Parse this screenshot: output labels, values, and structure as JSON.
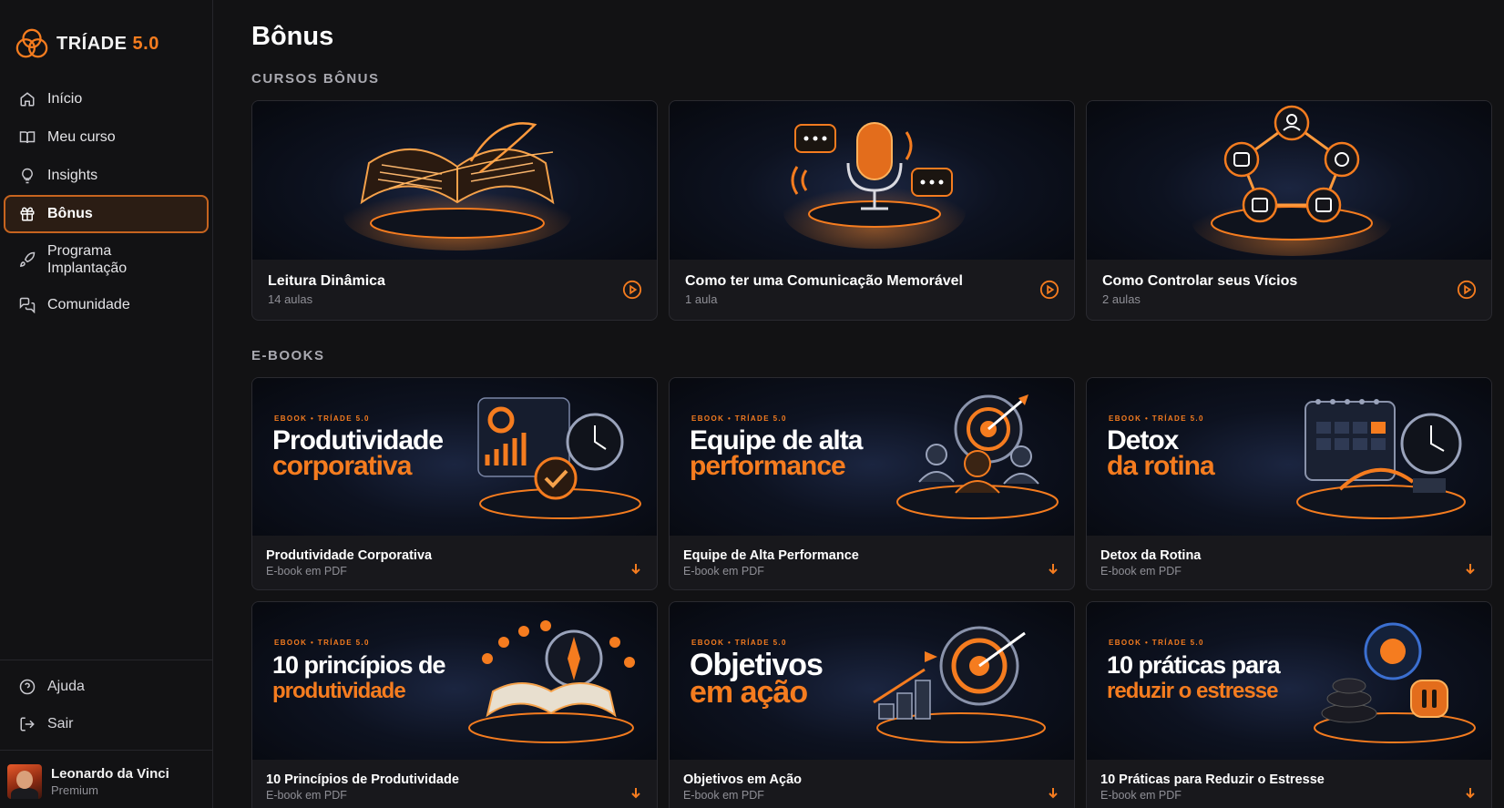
{
  "sidebar": {
    "brand": {
      "text": "TRÍADE",
      "version": "5.0"
    },
    "items": [
      {
        "label": "Início",
        "icon": "home-icon"
      },
      {
        "label": "Meu curso",
        "icon": "book-icon"
      },
      {
        "label": "Insights",
        "icon": "lightbulb-icon"
      },
      {
        "label": "Bônus",
        "icon": "gift-icon",
        "active": true
      },
      {
        "label": "Programa\nImplantação",
        "icon": "rocket-icon"
      },
      {
        "label": "Comunidade",
        "icon": "chat-icon"
      }
    ],
    "bottom": [
      {
        "label": "Ajuda",
        "icon": "help-icon"
      },
      {
        "label": "Sair",
        "icon": "logout-icon"
      }
    ],
    "user": {
      "name": "Leonardo da Vinci",
      "plan": "Premium"
    }
  },
  "main": {
    "title": "Bônus",
    "courses_section": "CURSOS BÔNUS",
    "courses": [
      {
        "title": "Leitura Dinâmica",
        "subtitle": "14 aulas",
        "art": "book"
      },
      {
        "title": "Como ter uma Comunicação Memorável",
        "subtitle": "1 aula",
        "art": "mic"
      },
      {
        "title": "Como Controlar seus Vícios",
        "subtitle": "2 aulas",
        "art": "network"
      }
    ],
    "ebooks_section": "E-BOOKS",
    "ebooks": [
      {
        "title": "Produtividade Corporativa",
        "subtitle": "E-book em PDF",
        "tag": "EBOOK • TRÍADE 5.0",
        "cover1": "Produtividade",
        "cover2": "corporativa"
      },
      {
        "title": "Equipe de Alta Performance",
        "subtitle": "E-book em PDF",
        "tag": "EBOOK • TRÍADE 5.0",
        "cover1": "Equipe de alta",
        "cover2": "performance"
      },
      {
        "title": "Detox da Rotina",
        "subtitle": "E-book em PDF",
        "tag": "EBOOK • TRÍADE 5.0",
        "cover1": "Detox",
        "cover2": "da rotina"
      },
      {
        "title": "10 Princípios de Produtividade",
        "subtitle": "E-book em PDF",
        "tag": "EBOOK • TRÍADE 5.0",
        "cover1": "10 princípios de",
        "cover2": "produtividade"
      },
      {
        "title": "Objetivos em Ação",
        "subtitle": "E-book em PDF",
        "tag": "EBOOK • TRÍADE 5.0",
        "cover1": "Objetivos",
        "cover2": "em ação"
      },
      {
        "title": "10 Práticas para Reduzir o Estresse",
        "subtitle": "E-book em PDF",
        "tag": "EBOOK • TRÍADE 5.0",
        "cover1": "10 práticas para",
        "cover2": "reduzir o estresse"
      }
    ]
  },
  "colors": {
    "accent": "#f57c1f",
    "background": "#121214",
    "card": "#18181c"
  }
}
